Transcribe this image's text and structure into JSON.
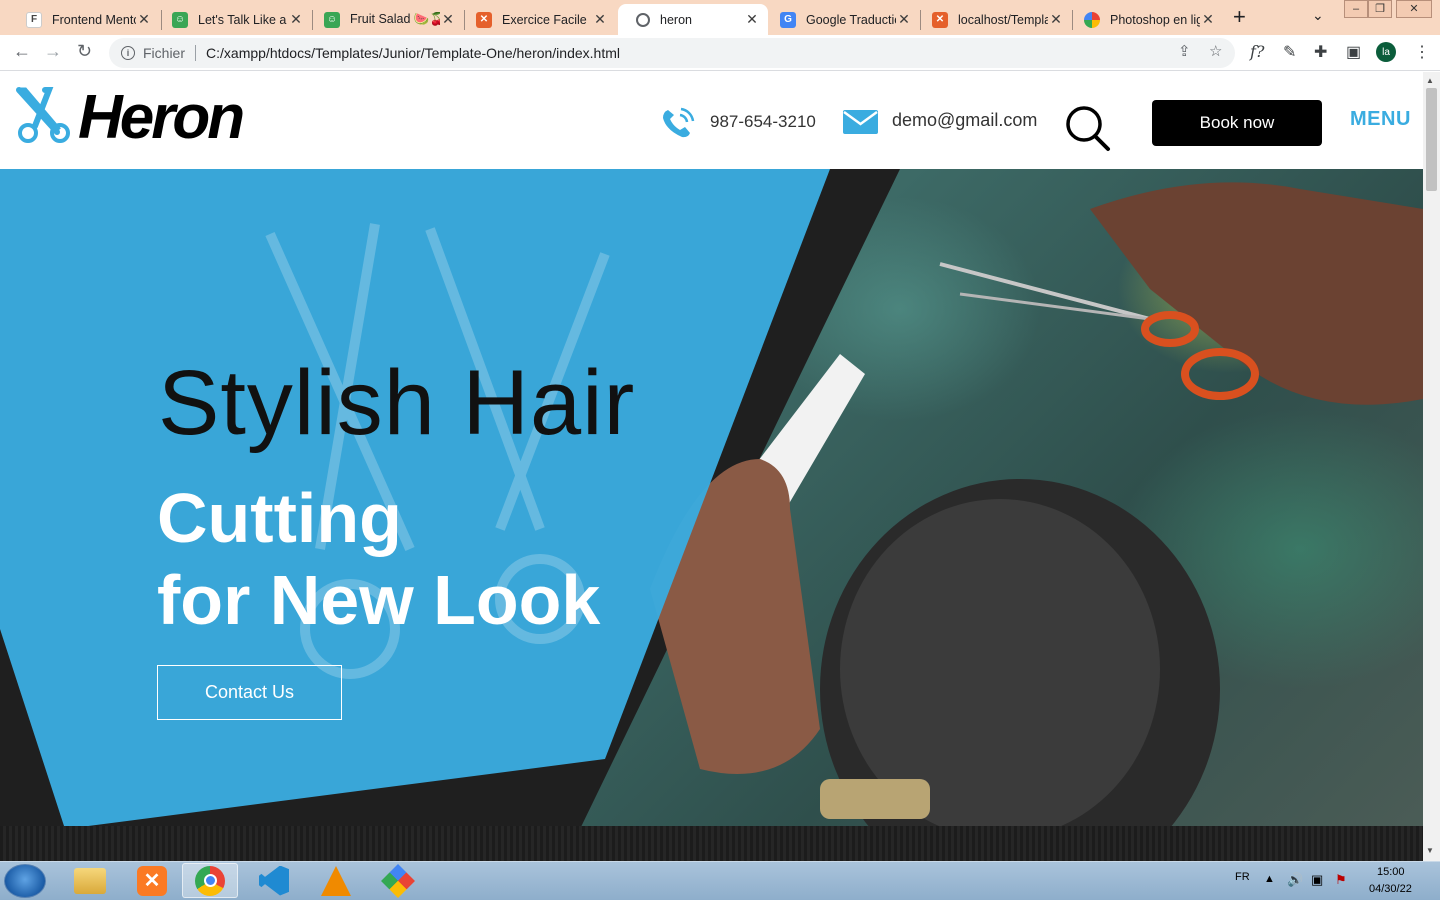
{
  "browser": {
    "tabs": [
      {
        "title": "Frontend Mentor",
        "favicon": "frontend-mentor-icon",
        "color": "#ffffff"
      },
      {
        "title": "Let's Talk Like a P",
        "favicon": "smiley-icon",
        "color": "#3aa655"
      },
      {
        "title": "Fruit Salad 🍉🍒🍓",
        "favicon": "smiley-icon",
        "color": "#3aa655"
      },
      {
        "title": "Exercice Facile",
        "favicon": "xampp-icon",
        "color": "#e5602b"
      },
      {
        "title": "heron",
        "favicon": "globe-icon",
        "color": "#5f6368"
      },
      {
        "title": "Google Traduction",
        "favicon": "google-translate-icon",
        "color": "#4285f4"
      },
      {
        "title": "localhost/Templa",
        "favicon": "xampp-icon",
        "color": "#e5602b"
      },
      {
        "title": "Photoshop en lig",
        "favicon": "photoshop-online-icon",
        "color": "#e2a33b"
      }
    ],
    "active_tab_index": 4,
    "new_tab_label": "+",
    "address": {
      "scheme_label": "Fichier",
      "url": "C:/xampp/htdocs/Templates/Junior/Template-One/heron/index.html"
    },
    "profile_initials": "la"
  },
  "site": {
    "logo_text": "Heron",
    "phone": "987-654-3210",
    "email": "demo@gmail.com",
    "book_button": "Book now",
    "menu_label": "MENU",
    "accent_color": "#3aace0",
    "hero": {
      "line1": "Stylish Hair",
      "line2a": "Cutting",
      "line2b": "for New Look",
      "cta": "Contact Us"
    }
  },
  "taskbar": {
    "apps": [
      "file-explorer-icon",
      "xampp-icon",
      "chrome-icon",
      "vscode-icon",
      "vlc-icon",
      "git-icon"
    ],
    "active_app": "chrome-icon",
    "language": "FR",
    "time": "15:00",
    "date": "04/30/22"
  }
}
